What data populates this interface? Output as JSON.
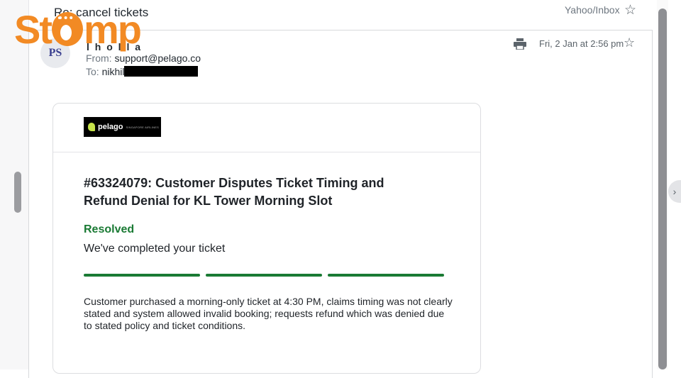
{
  "thread": {
    "subject": "Re: cancel tickets",
    "folder": "Yahoo/Inbox"
  },
  "brand": {
    "logo_text_left": "St",
    "logo_text_right": "mp",
    "color": "#f28a24"
  },
  "message": {
    "avatar_initials": "PS",
    "sender_name": "l   h   o   l   l   a",
    "from_label": "From:",
    "from_value": "support@pelago.co",
    "to_label": "To:",
    "to_value": "nikhil",
    "date": "Fri, 2 Jan at 2:56 pm"
  },
  "email": {
    "banner_brand": "pelago",
    "banner_partner": "SINGAPORE AIRLINES",
    "ticket_title": "#63324079: Customer Disputes Ticket Timing and Refund Denial for KL Tower Morning Slot",
    "status_label": "Resolved",
    "status_message": "We've completed your ticket",
    "progress_steps_completed": 3,
    "progress_steps_total": 3,
    "description": "Customer purchased a morning-only ticket at 4:30 PM, claims timing was not clearly stated and system allowed invalid booking; requests refund which was denied due to stated policy and ticket conditions."
  },
  "colors": {
    "status_green": "#1a7a34",
    "brand_orange": "#f28a24"
  },
  "icons": {
    "star": "star-outline-icon",
    "print": "print-icon",
    "expand": "chevron-right-icon"
  }
}
